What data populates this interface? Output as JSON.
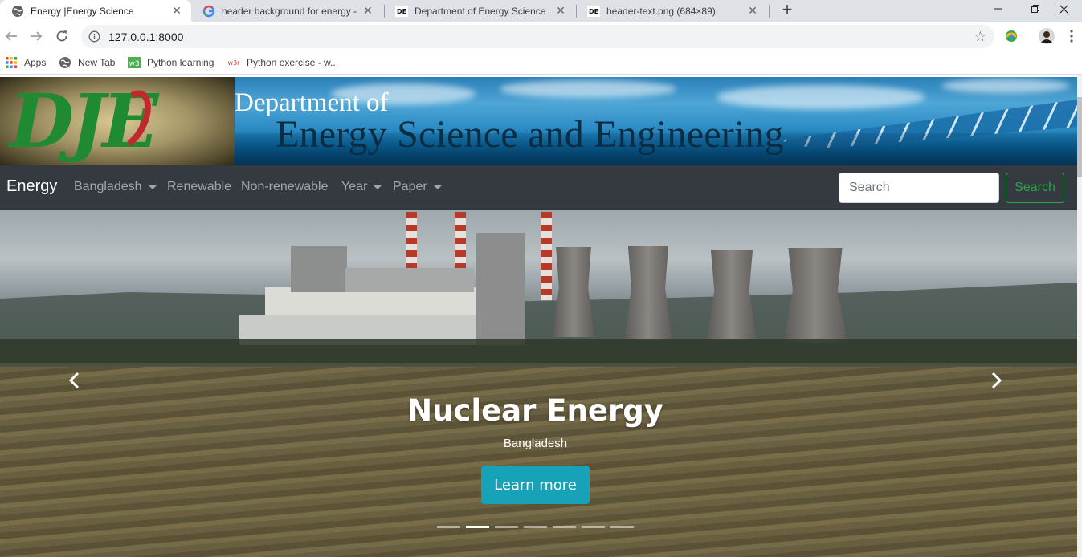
{
  "browser": {
    "tabs": [
      {
        "title": "Energy |Energy Science",
        "active": true,
        "icon": "globe-icon"
      },
      {
        "title": "header background for energy -",
        "active": false,
        "icon": "google-icon"
      },
      {
        "title": "Department of Energy Science an",
        "active": false,
        "icon": "deje-favicon"
      },
      {
        "title": "header-text.png (684×89)",
        "active": false,
        "icon": "deje-favicon"
      }
    ],
    "new_tab_symbol": "+",
    "url": "127.0.0.1:8000",
    "bookmarks": [
      {
        "label": "Apps",
        "icon": "apps-grid-icon"
      },
      {
        "label": "New Tab",
        "icon": "globe-icon"
      },
      {
        "label": "Python learning",
        "icon": "w3schools-icon"
      },
      {
        "label": "Python exercise - w...",
        "icon": "w3resource-icon"
      }
    ]
  },
  "header": {
    "logo_text": "DJE",
    "title_line1": "Department of",
    "title_line2": "Energy Science and Engineering"
  },
  "navbar": {
    "brand": "Energy",
    "links": [
      {
        "label": "Bangladesh",
        "dropdown": true
      },
      {
        "label": "Renewable",
        "dropdown": false
      },
      {
        "label": "Non-renewable",
        "dropdown": false
      },
      {
        "label": "Year",
        "dropdown": true
      },
      {
        "label": "Paper",
        "dropdown": true
      }
    ],
    "search_placeholder": "Search",
    "search_button": "Search"
  },
  "carousel": {
    "title": "Nuclear Energy",
    "subtitle": "Bangladesh",
    "button_label": "Learn more",
    "slide_count": 7,
    "active_index": 1
  },
  "colors": {
    "navbar_bg": "#343a40",
    "search_accent": "#28a745",
    "button_accent": "#17a2b8"
  }
}
